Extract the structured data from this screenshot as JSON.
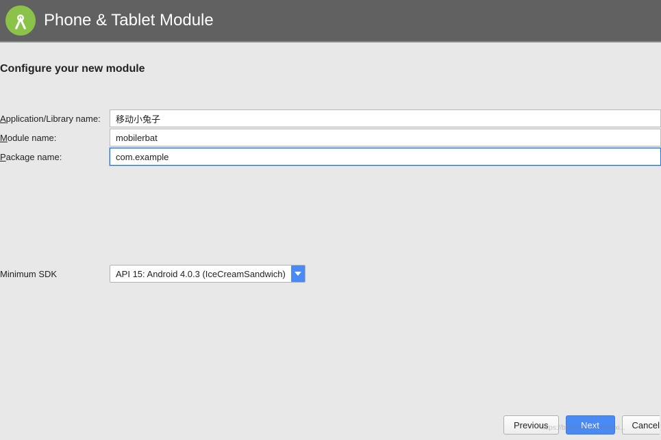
{
  "header": {
    "title": "Phone & Tablet Module"
  },
  "section": {
    "title": "Configure your new module"
  },
  "form": {
    "appNameLabelPrefix": "A",
    "appNameLabelRest": "pplication/Library name:",
    "appNameValue": "移动小兔子",
    "moduleNameLabelPrefix": "M",
    "moduleNameLabelRest": "odule name:",
    "moduleNameValue": "mobilerbat",
    "packageNameLabelPrefix": "P",
    "packageNameLabelRest": "ackage name:",
    "packageNameValue": "com.example"
  },
  "sdk": {
    "label": "Minimum SDK",
    "selected": "API 15: Android 4.0.3 (IceCreamSandwich)"
  },
  "buttons": {
    "previous": "Previous",
    "next": "Next",
    "cancel": "Cancel"
  },
  "watermark": "https://blog.csdn.net/weixi..."
}
